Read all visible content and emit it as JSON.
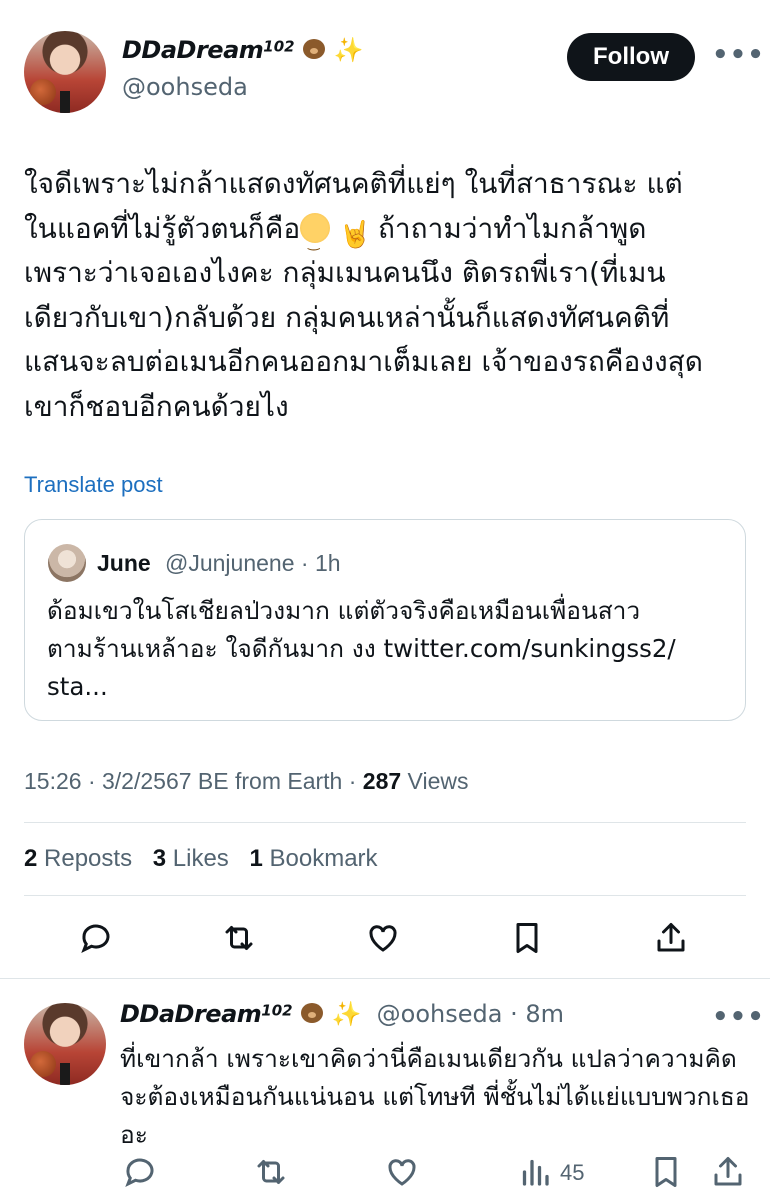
{
  "post": {
    "author_name": "DDaDream",
    "author_sup": "102",
    "author_handle": "@oohseda",
    "follow_label": "Follow",
    "more_label": "•••",
    "text_lines": [
      "ใจดีเพราะไม่กล้าแสดงทัศนคติที่แย่ๆ ในที่สาธารณะ แต่",
      "ในแอคที่ไม่รู้ตัวตนก็คือ",
      " ถ้าถามว่าทำไมกล้าพูด",
      "เพราะว่าเจอเองไงคะ กลุ่มเมนคนนึง ติดรถพี่เรา(ที่เมน",
      "เดียวกับเขา)กลับด้วย กลุ่มคนเหล่านั้นก็แสดงทัศนคติที่",
      "แสนจะลบต่อเมนอีกคนออกมาเต็มเลย เจ้าของรถคืองงสุด",
      "เขาก็ชอบอีกคนด้วยไง"
    ],
    "translate_label": "Translate post",
    "quote": {
      "name": "June",
      "handle": "@Junjunene · 1h",
      "text_line1": "ด้อมเขวในโสเชียลป่วงมาก แต่ตัวจริงคือเหมือนเพื่อนสาว",
      "text_line2": "ตามร้านเหล้าอะ ใจดีกันมาก งง twitter.com/sunkingss2/",
      "text_line3": "sta..."
    },
    "meta_time": "15:26 · 3/2/2567 BE from Earth · ",
    "meta_views_count": "287",
    "meta_views_label": " Views",
    "reposts_count": "2",
    "reposts_label": " Reposts",
    "likes_count": "3",
    "likes_label": " Likes",
    "bookmarks_count": "1",
    "bookmarks_label": " Bookmark"
  },
  "reply": {
    "author_name": "DDaDream",
    "author_sup": "102",
    "handle_time": "@oohseda · 8m",
    "more_label": "•••",
    "text": "ที่เขากล้า เพราะเขาคิดว่านี่คือเมนเดียวกัน แปลว่าความคิดจะต้องเหมือนกันแน่นอน แต่โทษที พี่ชั้นไม่ได้แย่แบบพวกเธออะ",
    "views": "45"
  },
  "icons": {
    "reply": "reply-icon",
    "repost": "repost-icon",
    "like": "heart-icon",
    "bookmark": "bookmark-icon",
    "share": "share-icon",
    "views": "views-icon"
  },
  "colors": {
    "link": "#1d6fbf",
    "secondary": "#536471",
    "primary_text": "#0f1419",
    "follow_bg": "#0f1419"
  }
}
